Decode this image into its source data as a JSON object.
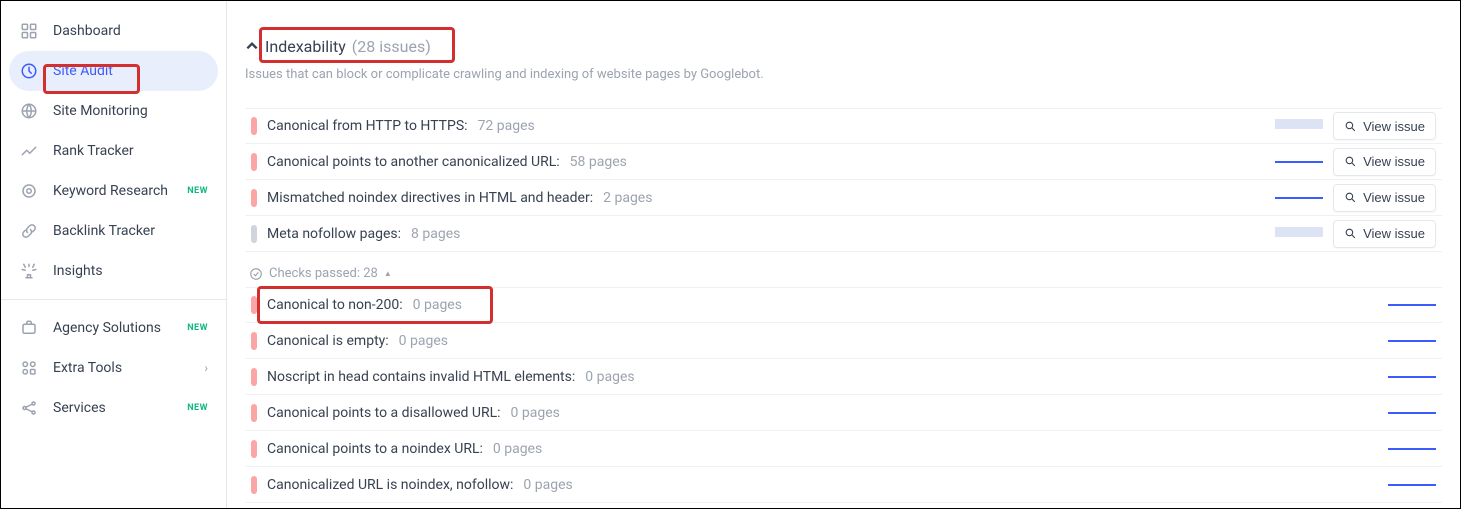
{
  "sidebar": {
    "items": [
      {
        "label": "Dashboard",
        "icon": "dashboard",
        "chevron": false
      },
      {
        "label": "Site Audit",
        "icon": "audit",
        "active": true
      },
      {
        "label": "Site Monitoring",
        "icon": "monitoring"
      },
      {
        "label": "Rank Tracker",
        "icon": "rank"
      },
      {
        "label": "Keyword Research",
        "icon": "keyword",
        "badge": "NEW"
      },
      {
        "label": "Backlink Tracker",
        "icon": "backlink"
      },
      {
        "label": "Insights",
        "icon": "insights"
      }
    ],
    "items2": [
      {
        "label": "Agency Solutions",
        "icon": "agency",
        "badge": "NEW"
      },
      {
        "label": "Extra Tools",
        "icon": "tools",
        "chevron": true
      },
      {
        "label": "Services",
        "icon": "services",
        "badge": "NEW"
      }
    ]
  },
  "section": {
    "title": "Indexability",
    "count_label": "(28 issues)",
    "desc": "Issues that can block or complicate crawling and indexing of website pages by Googlebot."
  },
  "issues_top": [
    {
      "label": "Canonical from HTTP to HTTPS:",
      "count": "72 pages",
      "sev": "red",
      "spark": "bar",
      "view": true
    },
    {
      "label": "Canonical points to another canonicalized URL:",
      "count": "58 pages",
      "sev": "red",
      "spark": "line",
      "view": true
    },
    {
      "label": "Mismatched noindex directives in HTML and header:",
      "count": "2 pages",
      "sev": "red",
      "spark": "line",
      "view": true
    },
    {
      "label": "Meta nofollow pages:",
      "count": "8 pages",
      "sev": "grey",
      "spark": "bar",
      "view": true
    }
  ],
  "checks_passed": {
    "label": "Checks passed: 28"
  },
  "issues_passed": [
    {
      "label": "Canonical to non-200:",
      "count": "0 pages",
      "sev": "red",
      "spark": "line",
      "highlight": true
    },
    {
      "label": "Canonical is empty:",
      "count": "0 pages",
      "sev": "red",
      "spark": "line"
    },
    {
      "label": "Noscript in head contains invalid HTML elements:",
      "count": "0 pages",
      "sev": "red",
      "spark": "line"
    },
    {
      "label": "Canonical points to a disallowed URL:",
      "count": "0 pages",
      "sev": "red",
      "spark": "line"
    },
    {
      "label": "Canonical points to a noindex URL:",
      "count": "0 pages",
      "sev": "red",
      "spark": "line"
    },
    {
      "label": "Canonicalized URL is noindex, nofollow:",
      "count": "0 pages",
      "sev": "red",
      "spark": "line"
    }
  ],
  "view_issue_label": "View issue"
}
